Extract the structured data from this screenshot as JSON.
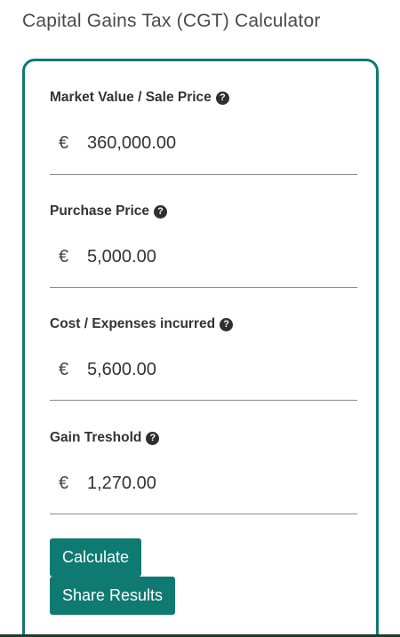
{
  "header": {
    "title": "Capital Gains Tax (CGT) Calculator"
  },
  "form": {
    "fields": [
      {
        "label": "Market Value / Sale Price",
        "currency": "€",
        "value": "360,000.00"
      },
      {
        "label": "Purchase Price",
        "currency": "€",
        "value": "5,000.00"
      },
      {
        "label": "Cost / Expenses incurred",
        "currency": "€",
        "value": "5,600.00"
      },
      {
        "label": "Gain Treshold",
        "currency": "€",
        "value": "1,270.00"
      }
    ],
    "help_icon_glyph": "?"
  },
  "actions": {
    "calculate_label": "Calculate",
    "share_label": "Share Results"
  },
  "colors": {
    "accent": "#0f7a72",
    "text": "#333333",
    "help_icon_bg": "#2f2f2f"
  },
  "icons": {
    "help": "question-circle-icon"
  }
}
